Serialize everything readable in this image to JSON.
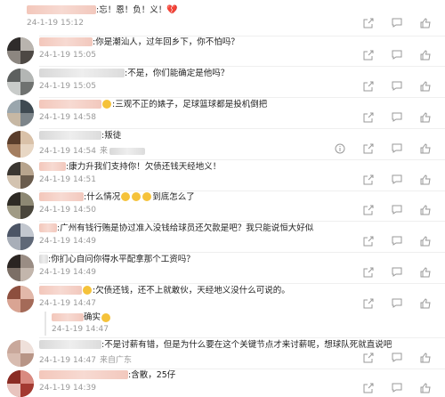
{
  "comments": [
    {
      "text": ":忘！恩！负！义！",
      "heart": "💔",
      "time": "24-1-19 15:12",
      "location": "",
      "has_info": false,
      "name_w": 78,
      "grey": false
    },
    {
      "text": ":你是潮汕人，过年回乡下，你不怕吗？",
      "time": "24-1-19 15:05",
      "location": "",
      "has_info": false,
      "name_w": 60,
      "grey": false
    },
    {
      "text": ":不是，你们能确定是他吗？",
      "time": "24-1-19 15:05",
      "location": "",
      "has_info": false,
      "name_w": 96,
      "grey": true
    },
    {
      "text": ":三观不正的婊子，足球篮球都是投机倒把",
      "time": "24-1-19 14:58",
      "location": "",
      "has_info": false,
      "name_w": 70,
      "grey": false
    },
    {
      "text": ":叛徒",
      "time": "24-1-19 14:54",
      "location": "来",
      "has_info": true,
      "name_w": 70,
      "grey": true
    },
    {
      "text": ":康力升我们支持你！欠债还钱天经地义！",
      "time": "24-1-19 14:51",
      "location": "",
      "has_info": false,
      "name_w": 30,
      "grey": false
    },
    {
      "text": ":什么情况",
      "text2": "到底怎么了",
      "time": "24-1-19 14:50",
      "location": "",
      "has_info": false,
      "name_w": 50,
      "grey": false
    },
    {
      "text": ":广州有钱行贿是协过准入没钱给球员还欠款是吧？我只能说恒大好似",
      "time": "24-1-19 14:49",
      "location": "",
      "has_info": false,
      "name_w": 20,
      "grey": false
    },
    {
      "text": ":你扪心自问你得水平配拿那个工资吗？",
      "time": "24-1-19 14:49",
      "location": "",
      "has_info": false,
      "name_w": 10,
      "grey": true
    },
    {
      "text": ":欠债还钱，还不上就敢伙，天经地义没什么可说的。",
      "time": "24-1-19 14:47",
      "location": "",
      "has_info": false,
      "name_w": 48,
      "grey": false
    },
    {
      "text": ":不是讨薪有错，但是为什么要在这个关键节点才来讨薪呢，想球队死就直说吧",
      "time": "24-1-19 14:47",
      "location": "来自广东",
      "has_info": false,
      "name_w": 70,
      "grey": true
    },
    {
      "text": ":含散，25仔",
      "time": "24-1-19 14:39",
      "location": "",
      "has_info": false,
      "name_w": 100,
      "grey": false
    }
  ],
  "reply": {
    "text": "确实",
    "time": "24-1-19 14:47"
  }
}
